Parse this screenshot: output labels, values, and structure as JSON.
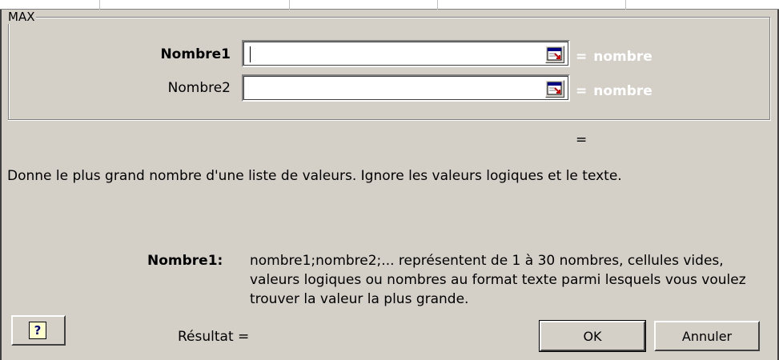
{
  "function_name": "MAX",
  "arguments": [
    {
      "label": "Nombre1",
      "value": "",
      "result": "nombre",
      "equals": "="
    },
    {
      "label": "Nombre2",
      "value": "",
      "result": "nombre",
      "equals": "="
    }
  ],
  "formula_result_equals": "=",
  "description": "Donne le plus grand nombre d'une liste de valeurs. Ignore les valeurs logiques et le texte.",
  "help": {
    "name": "Nombre1:",
    "text": "nombre1;nombre2;... représentent de 1 à 30 nombres, cellules vides, valeurs logiques ou nombres au format texte parmi lesquels vous voulez trouver la valeur la plus grande."
  },
  "help_button": {
    "glyph": "?",
    "icon": "help-icon"
  },
  "result_label": "Résultat =",
  "buttons": {
    "ok": "OK",
    "cancel": "Annuler"
  }
}
